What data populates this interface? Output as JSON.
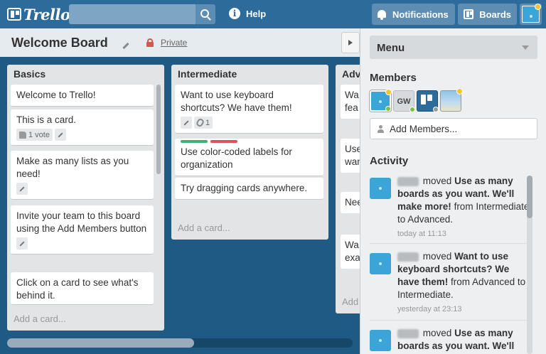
{
  "header": {
    "logo_text": "Trello",
    "search_placeholder": "",
    "help_label": "Help",
    "notifications_label": "Notifications",
    "boards_label": "Boards"
  },
  "board": {
    "title": "Welcome Board",
    "visibility": "Private"
  },
  "lists": [
    {
      "title": "Basics",
      "cards": [
        {
          "text": "Welcome to Trello!"
        },
        {
          "text": "This is a card.",
          "votes": "1 vote"
        },
        {
          "text": "Make as many lists as you need!"
        },
        {
          "text": "Invite your team to this board using the Add Members button"
        },
        {
          "text": "Click on a card to see what's behind it."
        }
      ],
      "add_card": "Add a card..."
    },
    {
      "title": "Intermediate",
      "cards": [
        {
          "text": "Want to use keyboard shortcuts? We have them!",
          "attachments": "1"
        },
        {
          "text": "Use color-coded labels for organization",
          "labels": [
            "#3cb371",
            "#e0505a"
          ]
        },
        {
          "text": "Try dragging cards anywhere."
        }
      ],
      "add_card": "Add a card..."
    },
    {
      "title": "Adv",
      "cards": [
        {
          "line1": "Wa",
          "line2": "fea"
        },
        {
          "line1": "Use",
          "line2": "wan"
        },
        {
          "line1": "Nee"
        },
        {
          "line1": "Wa",
          "line2": "exa"
        }
      ],
      "add_card": "Add"
    }
  ],
  "sidebar": {
    "menu_title": "Menu",
    "members_title": "Members",
    "member_initials": "GW",
    "add_members_label": "Add Members...",
    "activity_title": "Activity",
    "activity": [
      {
        "verb": "moved",
        "card": "Use as many boards as you want. We'll make more!",
        "detail": "from Intermediate to Advanced.",
        "time": "today at 11:13"
      },
      {
        "verb": "moved",
        "card": "Want to use keyboard shortcuts? We have them!",
        "detail": "from Advanced to Intermediate.",
        "time": "yesterday at 23:13"
      },
      {
        "verb": "moved",
        "card": "Use as many boards as you want. We'll",
        "detail": "",
        "time": ""
      }
    ]
  },
  "colors": {
    "board_bg": "#1f5a85",
    "header_bg": "#2c6b9a",
    "private_lock": "#d9534f"
  }
}
